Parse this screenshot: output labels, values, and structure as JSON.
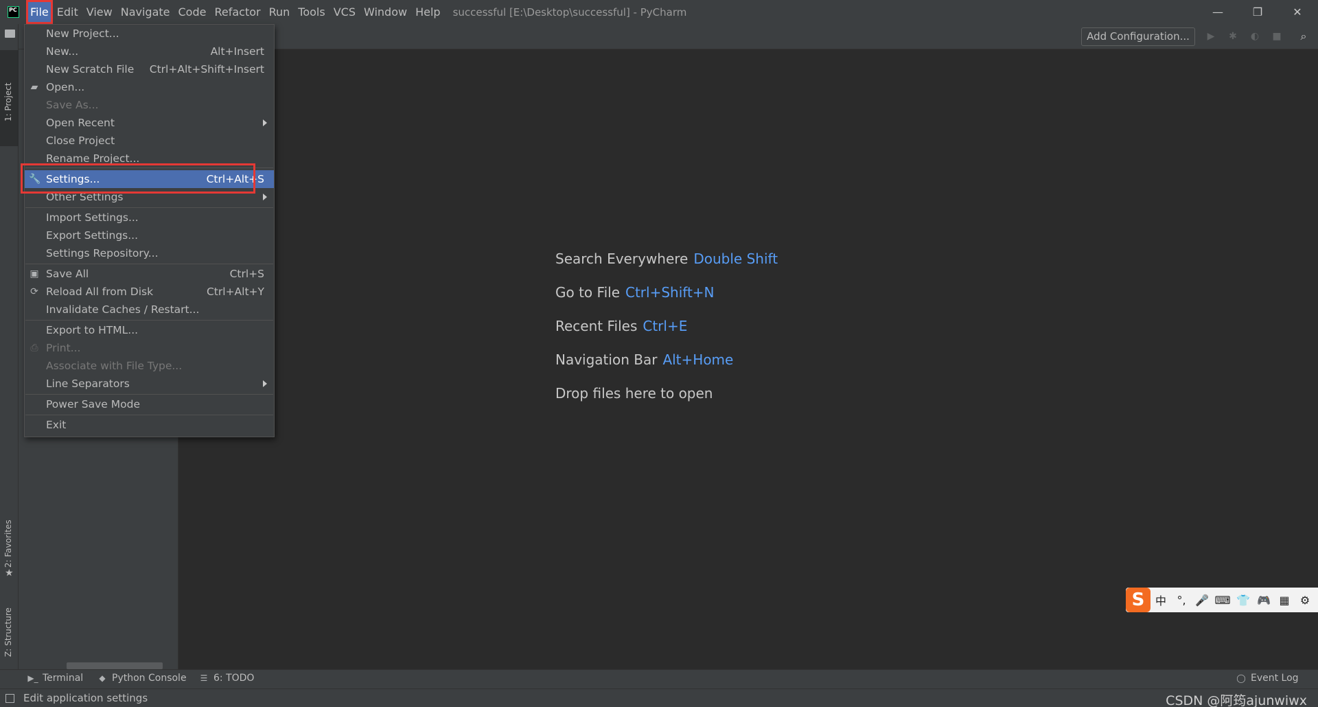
{
  "titlebar": {
    "menus": [
      "File",
      "Edit",
      "View",
      "Navigate",
      "Code",
      "Refactor",
      "Run",
      "Tools",
      "VCS",
      "Window",
      "Help"
    ],
    "window_title": "successful [E:\\Desktop\\successful] - PyCharm",
    "controls": {
      "minimize": "—",
      "restore": "❐",
      "close": "✕"
    }
  },
  "toolbar": {
    "add_configuration": "Add Configuration...",
    "icons": [
      "run-icon",
      "debug-icon",
      "coverage-icon",
      "stop-icon",
      "search-icon"
    ]
  },
  "left_strip": {
    "tabs": [
      "1: Project",
      "2: Favorites",
      "Z: Structure"
    ]
  },
  "file_menu": {
    "items": [
      {
        "label": "New Project...",
        "shortcut": "",
        "icon": "",
        "disabled": false,
        "submenu": false
      },
      {
        "label": "New...",
        "shortcut": "Alt+Insert",
        "icon": "",
        "disabled": false,
        "submenu": false
      },
      {
        "label": "New Scratch File",
        "shortcut": "Ctrl+Alt+Shift+Insert",
        "icon": "",
        "disabled": false,
        "submenu": false
      },
      {
        "label": "Open...",
        "shortcut": "",
        "icon": "folder-icon",
        "disabled": false,
        "submenu": false
      },
      {
        "label": "Save As...",
        "shortcut": "",
        "icon": "",
        "disabled": true,
        "submenu": false
      },
      {
        "label": "Open Recent",
        "shortcut": "",
        "icon": "",
        "disabled": false,
        "submenu": true
      },
      {
        "label": "Close Project",
        "shortcut": "",
        "icon": "",
        "disabled": false,
        "submenu": false
      },
      {
        "label": "Rename Project...",
        "shortcut": "",
        "icon": "",
        "disabled": false,
        "submenu": false
      },
      {
        "label": "Settings...",
        "shortcut": "Ctrl+Alt+S",
        "icon": "wrench-icon",
        "disabled": false,
        "submenu": false,
        "selected": true
      },
      {
        "label": "Other Settings",
        "shortcut": "",
        "icon": "",
        "disabled": false,
        "submenu": true
      },
      {
        "label": "Import Settings...",
        "shortcut": "",
        "icon": "",
        "disabled": false,
        "submenu": false
      },
      {
        "label": "Export Settings...",
        "shortcut": "",
        "icon": "",
        "disabled": false,
        "submenu": false
      },
      {
        "label": "Settings Repository...",
        "shortcut": "",
        "icon": "",
        "disabled": false,
        "submenu": false
      },
      {
        "label": "Save All",
        "shortcut": "Ctrl+S",
        "icon": "save-icon",
        "disabled": false,
        "submenu": false
      },
      {
        "label": "Reload All from Disk",
        "shortcut": "Ctrl+Alt+Y",
        "icon": "reload-icon",
        "disabled": false,
        "submenu": false
      },
      {
        "label": "Invalidate Caches / Restart...",
        "shortcut": "",
        "icon": "",
        "disabled": false,
        "submenu": false
      },
      {
        "label": "Export to HTML...",
        "shortcut": "",
        "icon": "",
        "disabled": false,
        "submenu": false
      },
      {
        "label": "Print...",
        "shortcut": "",
        "icon": "print-icon",
        "disabled": true,
        "submenu": false
      },
      {
        "label": "Associate with File Type...",
        "shortcut": "",
        "icon": "",
        "disabled": true,
        "submenu": false
      },
      {
        "label": "Line Separators",
        "shortcut": "",
        "icon": "",
        "disabled": false,
        "submenu": true
      },
      {
        "label": "Power Save Mode",
        "shortcut": "",
        "icon": "",
        "disabled": false,
        "submenu": false
      },
      {
        "label": "Exit",
        "shortcut": "",
        "icon": "",
        "disabled": false,
        "submenu": false
      }
    ]
  },
  "editor_hints": [
    {
      "text": "Search Everywhere",
      "key": "Double Shift"
    },
    {
      "text": "Go to File",
      "key": "Ctrl+Shift+N"
    },
    {
      "text": "Recent Files",
      "key": "Ctrl+E"
    },
    {
      "text": "Navigation Bar",
      "key": "Alt+Home"
    },
    {
      "text": "Drop files here to open",
      "key": ""
    }
  ],
  "bottom_bar": {
    "tabs": [
      "Terminal",
      "Python Console",
      "6: TODO"
    ],
    "event_log": "Event Log"
  },
  "status_bar": {
    "text": "Edit application settings",
    "watermark": "CSDN @阿筠ajunwiwx"
  },
  "ime": {
    "logo": "S",
    "buttons": [
      "中",
      "°,",
      "🎤",
      "⌨",
      "👕",
      "🎮",
      "▦",
      "⚙"
    ]
  },
  "colors": {
    "accent_selection": "#4b6eaf",
    "highlight_box": "#e53935",
    "shortcut_blue": "#589df6",
    "background": "#2b2b2b",
    "panel": "#3c3f41"
  }
}
